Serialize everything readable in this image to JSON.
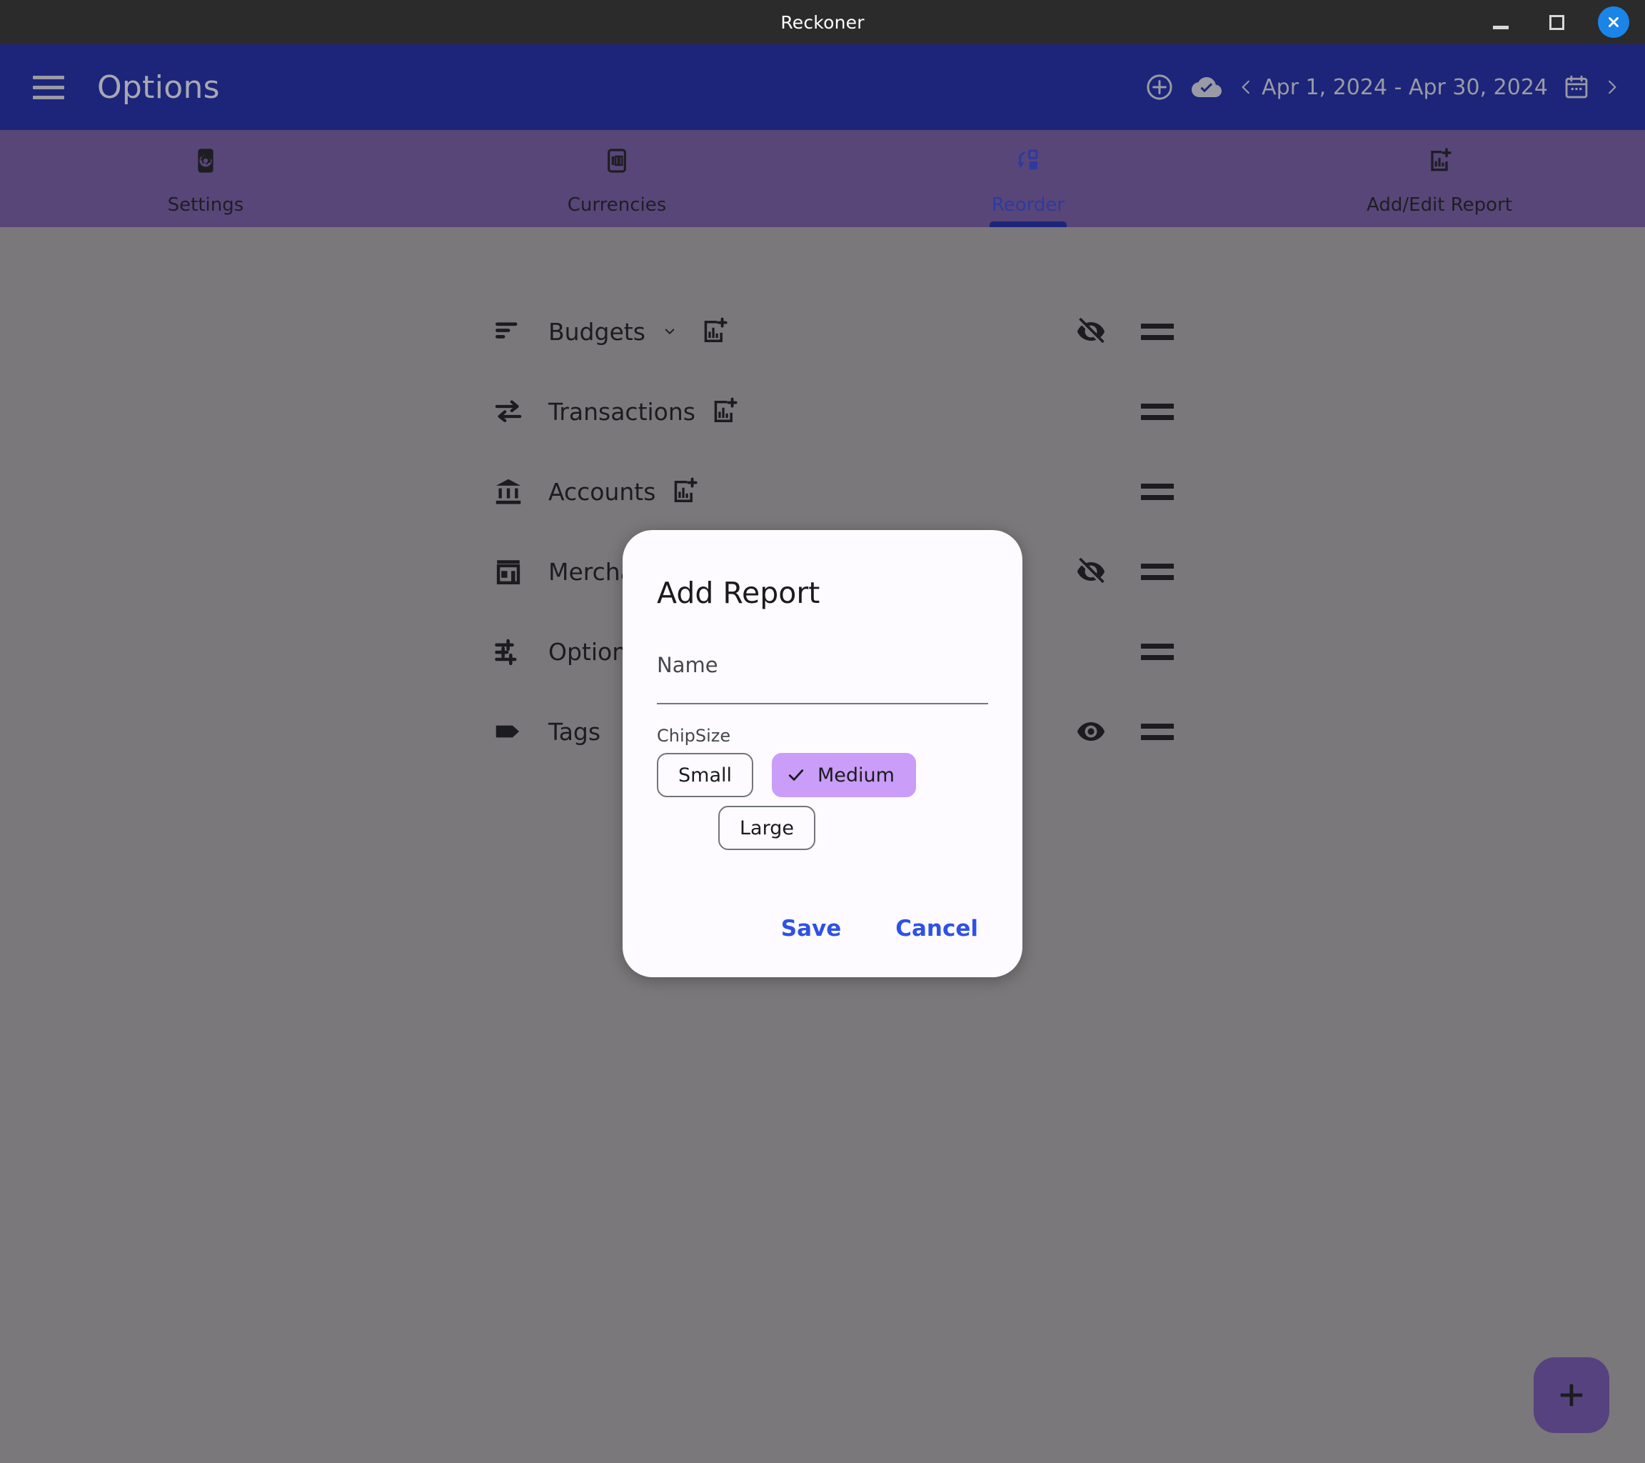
{
  "window": {
    "title": "Reckoner",
    "controls": {
      "minimize": "minimize-icon",
      "maximize": "maximize-icon",
      "close": "close-icon"
    }
  },
  "appbar": {
    "menu_icon": "hamburger-menu-icon",
    "title": "Options",
    "add_icon": "add-circle-icon",
    "cloud_icon": "cloud-done-icon",
    "prev_icon": "chevron-left-icon",
    "date_range": "Apr 1, 2024 - Apr 30, 2024",
    "calendar_icon": "calendar-icon",
    "next_icon": "chevron-right-icon"
  },
  "tabs": [
    {
      "label": "Settings",
      "icon": "gear-icon",
      "active": false
    },
    {
      "label": "Currencies",
      "icon": "money-100-icon",
      "active": false
    },
    {
      "label": "Reorder",
      "icon": "reorder-icon",
      "active": true
    },
    {
      "label": "Add/Edit Report",
      "icon": "chart-add-icon",
      "active": false
    }
  ],
  "reorder_list": [
    {
      "label": "Budgets",
      "lead_icon": "sort-icon",
      "has_chevron": true,
      "has_chart_add": true,
      "visibility": "hidden",
      "drag": "drag-handle-icon"
    },
    {
      "label": "Transactions",
      "lead_icon": "transfer-icon",
      "has_chevron": false,
      "has_chart_add": true,
      "visibility": "none",
      "drag": "drag-handle-icon"
    },
    {
      "label": "Accounts",
      "lead_icon": "bank-icon",
      "has_chevron": false,
      "has_chart_add": true,
      "visibility": "none",
      "drag": "drag-handle-icon"
    },
    {
      "label": "Merchants",
      "lead_icon": "store-icon",
      "has_chevron": false,
      "has_chart_add": false,
      "visibility": "hidden",
      "drag": "drag-handle-icon"
    },
    {
      "label": "Options",
      "lead_icon": "tune-icon",
      "has_chevron": false,
      "has_chart_add": false,
      "visibility": "none",
      "drag": "drag-handle-icon"
    },
    {
      "label": "Tags",
      "lead_icon": "tag-icon",
      "has_chevron": false,
      "has_chart_add": false,
      "visibility": "visible",
      "drag": "drag-handle-icon"
    }
  ],
  "fab": {
    "icon": "plus-icon"
  },
  "dialog": {
    "title": "Add Report",
    "name_field": {
      "label": "Name",
      "value": "",
      "placeholder": "Name"
    },
    "chip_group": {
      "label": "ChipSize",
      "options": [
        {
          "label": "Small",
          "selected": false
        },
        {
          "label": "Medium",
          "selected": true
        },
        {
          "label": "Large",
          "selected": false
        }
      ],
      "selected_value": "Medium"
    },
    "save_label": "Save",
    "cancel_label": "Cancel"
  },
  "colors": {
    "titlebar": "#2b2b2b",
    "appbar": "#1c2579",
    "tabbar": "#584679",
    "body": "#7a787a",
    "accent_blue": "#2f51e5",
    "chip_selected": "#c99df8",
    "fab": "#56427e",
    "dialog_surface": "#fdfbff",
    "close_button": "#1b84e7"
  }
}
